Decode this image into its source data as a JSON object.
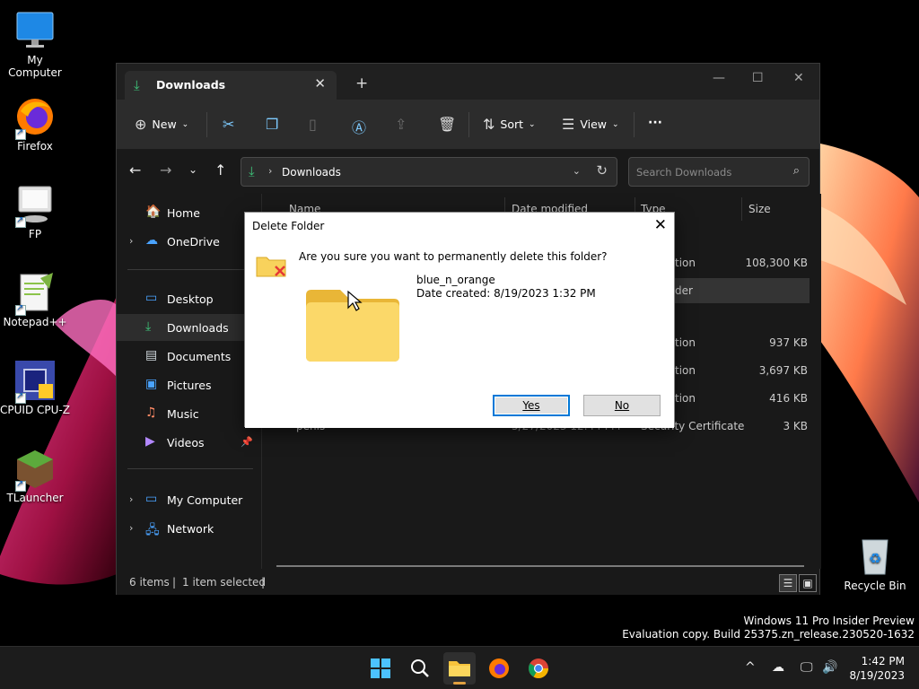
{
  "desktop": {
    "icons": [
      {
        "label": "My Computer"
      },
      {
        "label": "Firefox"
      },
      {
        "label": "FP"
      },
      {
        "label": "Notepad++"
      },
      {
        "label": "CPUID CPU-Z"
      },
      {
        "label": "TLauncher"
      },
      {
        "label": "Recycle Bin"
      }
    ]
  },
  "explorer": {
    "tab_title": "Downloads",
    "toolbar": {
      "new_label": "New",
      "sort_label": "Sort",
      "view_label": "View",
      "more_label": "···"
    },
    "address": {
      "path": "Downloads",
      "search_placeholder": "Search Downloads"
    },
    "sidebar": {
      "items": [
        {
          "label": "Home"
        },
        {
          "label": "OneDrive"
        },
        {
          "label": "Desktop"
        },
        {
          "label": "Downloads"
        },
        {
          "label": "Documents"
        },
        {
          "label": "Pictures"
        },
        {
          "label": "Music"
        },
        {
          "label": "Videos"
        },
        {
          "label": "My Computer"
        },
        {
          "label": "Network"
        }
      ]
    },
    "columns": {
      "name": "Name",
      "date": "Date modified",
      "type": "Type",
      "size": "Size"
    },
    "rows": [
      {
        "type": "tion",
        "size": "108,300 KB"
      },
      {
        "type": "der",
        "size": ""
      },
      {
        "type": "tion",
        "size": "937 KB"
      },
      {
        "type": "tion",
        "size": "3,697 KB"
      },
      {
        "type": "tion",
        "size": "416 KB"
      },
      {
        "name": "penis",
        "date": "5/27/2023 12:44 PM",
        "type": "Security Certificate",
        "size": "3 KB"
      }
    ],
    "status": {
      "items": "6 items",
      "selected": "1 item selected"
    }
  },
  "dialog": {
    "title": "Delete Folder",
    "question": "Are you sure you want to permanently delete this folder?",
    "folder_name": "blue_n_orange",
    "date_created": "Date created: 8/19/2023 1:32 PM",
    "yes_label": "Yes",
    "no_label": "No"
  },
  "watermark": {
    "line1": "Windows 11 Pro Insider Preview",
    "line2": "Evaluation copy. Build 25375.zn_release.230520-1632"
  },
  "taskbar": {
    "time": "1:42 PM",
    "date": "8/19/2023"
  },
  "colors": {
    "accent_green": "#3ec47a",
    "dialog_default_border": "#0078d7",
    "folder_yellow": "#f8d25c"
  }
}
